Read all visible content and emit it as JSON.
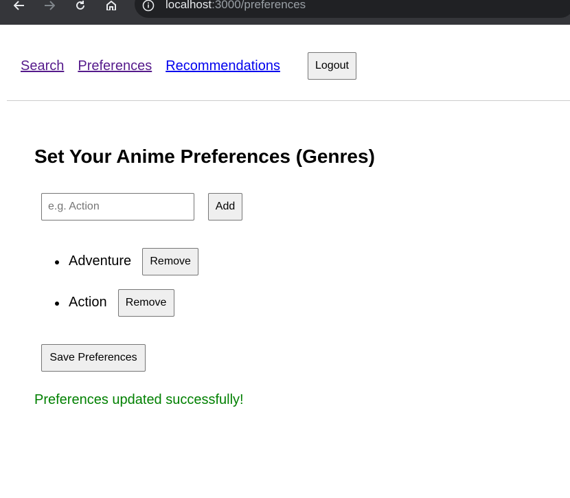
{
  "browser": {
    "url_host": "localhost",
    "url_rest": ":3000/preferences"
  },
  "nav": {
    "links": [
      {
        "label": "Search"
      },
      {
        "label": "Preferences"
      },
      {
        "label": "Recommendations"
      }
    ],
    "logout_label": "Logout"
  },
  "main": {
    "title": "Set Your Anime Preferences (Genres)",
    "input": {
      "value": "",
      "placeholder": "e.g. Action"
    },
    "add_label": "Add",
    "genres": [
      {
        "name": "Adventure",
        "remove_label": "Remove"
      },
      {
        "name": "Action",
        "remove_label": "Remove"
      }
    ],
    "save_label": "Save Preferences",
    "status_message": "Preferences updated successfully!"
  },
  "colors": {
    "visited_link": "#551a8b",
    "unvisited_link": "#0000ee",
    "success": "#008000",
    "chrome_bg": "#35363a"
  }
}
